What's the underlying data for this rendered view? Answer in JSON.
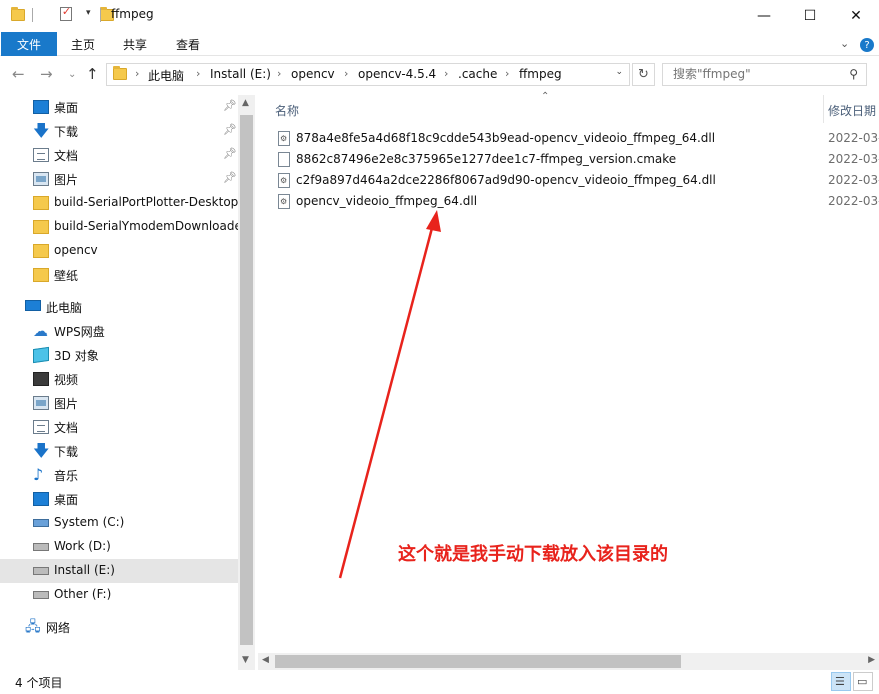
{
  "window": {
    "title": "ffmpeg",
    "minimize_glyph": "—",
    "maximize_glyph": "☐",
    "close_glyph": "✕"
  },
  "ribbon": {
    "file_tab": "文件",
    "tabs": [
      "主页",
      "共享",
      "查看"
    ],
    "expand_glyph": "⌄",
    "help_glyph": "?"
  },
  "address": {
    "crumbs": [
      "此电脑",
      "Install (E:)",
      "opencv",
      "opencv-4.5.4",
      ".cache",
      "ffmpeg"
    ],
    "separator": "›",
    "search_placeholder": "搜索\"ffmpeg\""
  },
  "nav": {
    "items": [
      {
        "label": "桌面",
        "icon": "desktop-icon",
        "pinned": true
      },
      {
        "label": "下载",
        "icon": "download-icon",
        "pinned": true
      },
      {
        "label": "文档",
        "icon": "document-icon",
        "pinned": true
      },
      {
        "label": "图片",
        "icon": "picture-icon",
        "pinned": true
      },
      {
        "label": "build-SerialPortPlotter-Desktop_",
        "icon": "folder-icon",
        "pinned": false
      },
      {
        "label": "build-SerialYmodemDownloade",
        "icon": "folder-icon",
        "pinned": false
      },
      {
        "label": "opencv",
        "icon": "folder-icon",
        "pinned": false
      },
      {
        "label": "壁纸",
        "icon": "folder-icon",
        "pinned": false
      },
      {
        "label": "此电脑",
        "icon": "this-pc-icon",
        "pinned": false
      },
      {
        "label": "WPS网盘",
        "icon": "cloud-icon",
        "pinned": false
      },
      {
        "label": "3D 对象",
        "icon": "3d-objects-icon",
        "pinned": false
      },
      {
        "label": "视频",
        "icon": "video-icon",
        "pinned": false
      },
      {
        "label": "图片",
        "icon": "picture-icon",
        "pinned": false
      },
      {
        "label": "文档",
        "icon": "document-icon",
        "pinned": false
      },
      {
        "label": "下载",
        "icon": "download-icon",
        "pinned": false
      },
      {
        "label": "音乐",
        "icon": "music-icon",
        "pinned": false
      },
      {
        "label": "桌面",
        "icon": "desktop-icon",
        "pinned": false
      },
      {
        "label": "System (C:)",
        "icon": "system-drive-icon",
        "pinned": false
      },
      {
        "label": "Work (D:)",
        "icon": "drive-icon",
        "pinned": false
      },
      {
        "label": "Install (E:)",
        "icon": "drive-icon",
        "pinned": false,
        "selected": true
      },
      {
        "label": "Other (F:)",
        "icon": "drive-icon",
        "pinned": false
      },
      {
        "label": "网络",
        "icon": "network-icon",
        "pinned": false
      }
    ]
  },
  "files": {
    "columns": {
      "name": "名称",
      "date": "修改日期"
    },
    "rows": [
      {
        "name": "878a4e8fe5a4d68f18c9cdde543b9ead-opencv_videoio_ffmpeg_64.dll",
        "date": "2022-03-",
        "type": "dll"
      },
      {
        "name": "8862c87496e2e8c375965e1277dee1c7-ffmpeg_version.cmake",
        "date": "2022-03-",
        "type": "cmake"
      },
      {
        "name": "c2f9a897d464a2dce2286f8067ad9d90-opencv_videoio_ffmpeg_64.dll",
        "date": "2022-03-",
        "type": "dll"
      },
      {
        "name": "opencv_videoio_ffmpeg_64.dll",
        "date": "2022-03-",
        "type": "dll"
      }
    ]
  },
  "annotation": {
    "text": "这个就是我手动下载放入该目录的",
    "color": "#e8231c"
  },
  "status": {
    "item_count": "4 个项目"
  },
  "colors": {
    "accent": "#1979ca",
    "selection": "#e5e5e5"
  }
}
